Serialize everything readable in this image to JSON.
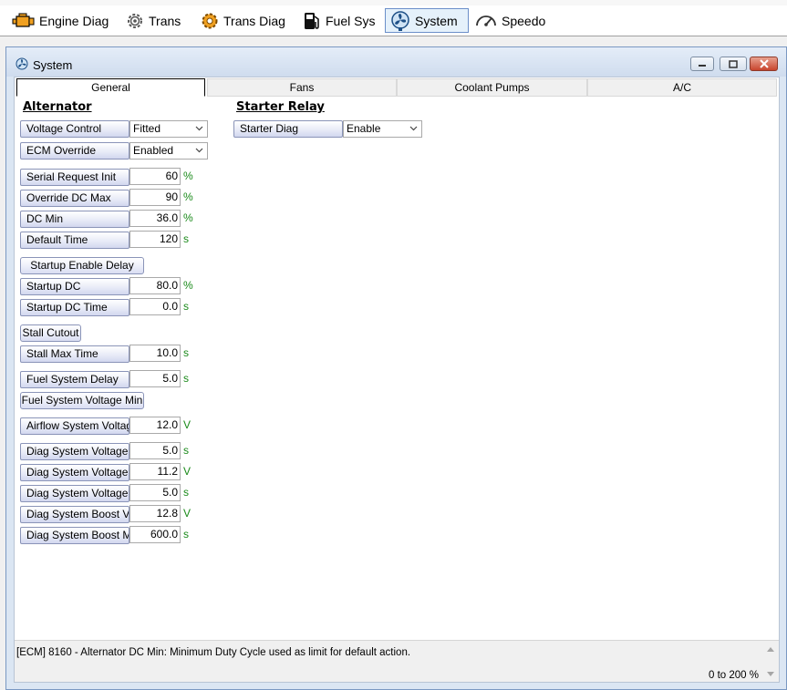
{
  "toolbar": {
    "items": [
      {
        "label": "Engine Diag",
        "icon": "engine-icon"
      },
      {
        "label": "Trans",
        "icon": "gear-icon"
      },
      {
        "label": "Trans Diag",
        "icon": "gear-warning-icon"
      },
      {
        "label": "Fuel Sys",
        "icon": "fuel-pump-icon"
      },
      {
        "label": "System",
        "icon": "fan-icon",
        "active": true
      },
      {
        "label": "Speedo",
        "icon": "speedometer-icon"
      }
    ]
  },
  "window": {
    "title": "System"
  },
  "tabs": [
    {
      "label": "General",
      "active": true
    },
    {
      "label": "Fans"
    },
    {
      "label": "Coolant Pumps"
    },
    {
      "label": "A/C"
    }
  ],
  "alternator": {
    "title": "Alternator",
    "voltage_control": {
      "label": "Voltage Control",
      "value": "Fitted"
    },
    "ecm_override": {
      "label": "ECM Override",
      "value": "Enabled"
    },
    "serial_request_init": {
      "label": "Serial Request Init",
      "value": "60",
      "unit": "%"
    },
    "override_dc_max": {
      "label": "Override DC Max",
      "value": "90",
      "unit": "%"
    },
    "dc_min": {
      "label": "DC Min",
      "value": "36.0",
      "unit": "%"
    },
    "default_time": {
      "label": "Default Time",
      "value": "120",
      "unit": "s"
    },
    "startup_enable_delay": {
      "label": "Startup Enable Delay"
    },
    "startup_dc": {
      "label": "Startup DC",
      "value": "80.0",
      "unit": "%"
    },
    "startup_dc_time": {
      "label": "Startup DC Time",
      "value": "0.0",
      "unit": "s"
    },
    "stall_cutout": {
      "label": "Stall Cutout"
    },
    "stall_max_time": {
      "label": "Stall Max Time",
      "value": "10.0",
      "unit": "s"
    },
    "fuel_system_delay": {
      "label": "Fuel System Delay",
      "value": "5.0",
      "unit": "s"
    },
    "fuel_system_voltage_min": {
      "label": "Fuel System Voltage Min"
    },
    "airflow_system_voltage": {
      "label": "Airflow System Voltage Min",
      "value": "12.0",
      "unit": "V"
    },
    "diag_voltage_delay": {
      "label": "Diag System Voltage Delay",
      "value": "5.0",
      "unit": "s"
    },
    "diag_voltage_low": {
      "label": "Diag System Voltage Low",
      "value": "11.2",
      "unit": "V"
    },
    "diag_voltage_low_time": {
      "label": "Diag System Voltage Low Time",
      "value": "5.0",
      "unit": "s"
    },
    "diag_boost_voltage": {
      "label": "Diag System Boost Voltage",
      "value": "12.8",
      "unit": "V"
    },
    "diag_boost_max": {
      "label": "Diag System Boost Max",
      "value": "600.0",
      "unit": "s"
    }
  },
  "starter_relay": {
    "title": "Starter Relay",
    "starter_diag": {
      "label": "Starter Diag",
      "value": "Enable"
    }
  },
  "status": {
    "description": "[ECM] 8160 - Alternator DC Min: Minimum Duty Cycle used as limit for default action.",
    "range": "0 to 200 %"
  }
}
